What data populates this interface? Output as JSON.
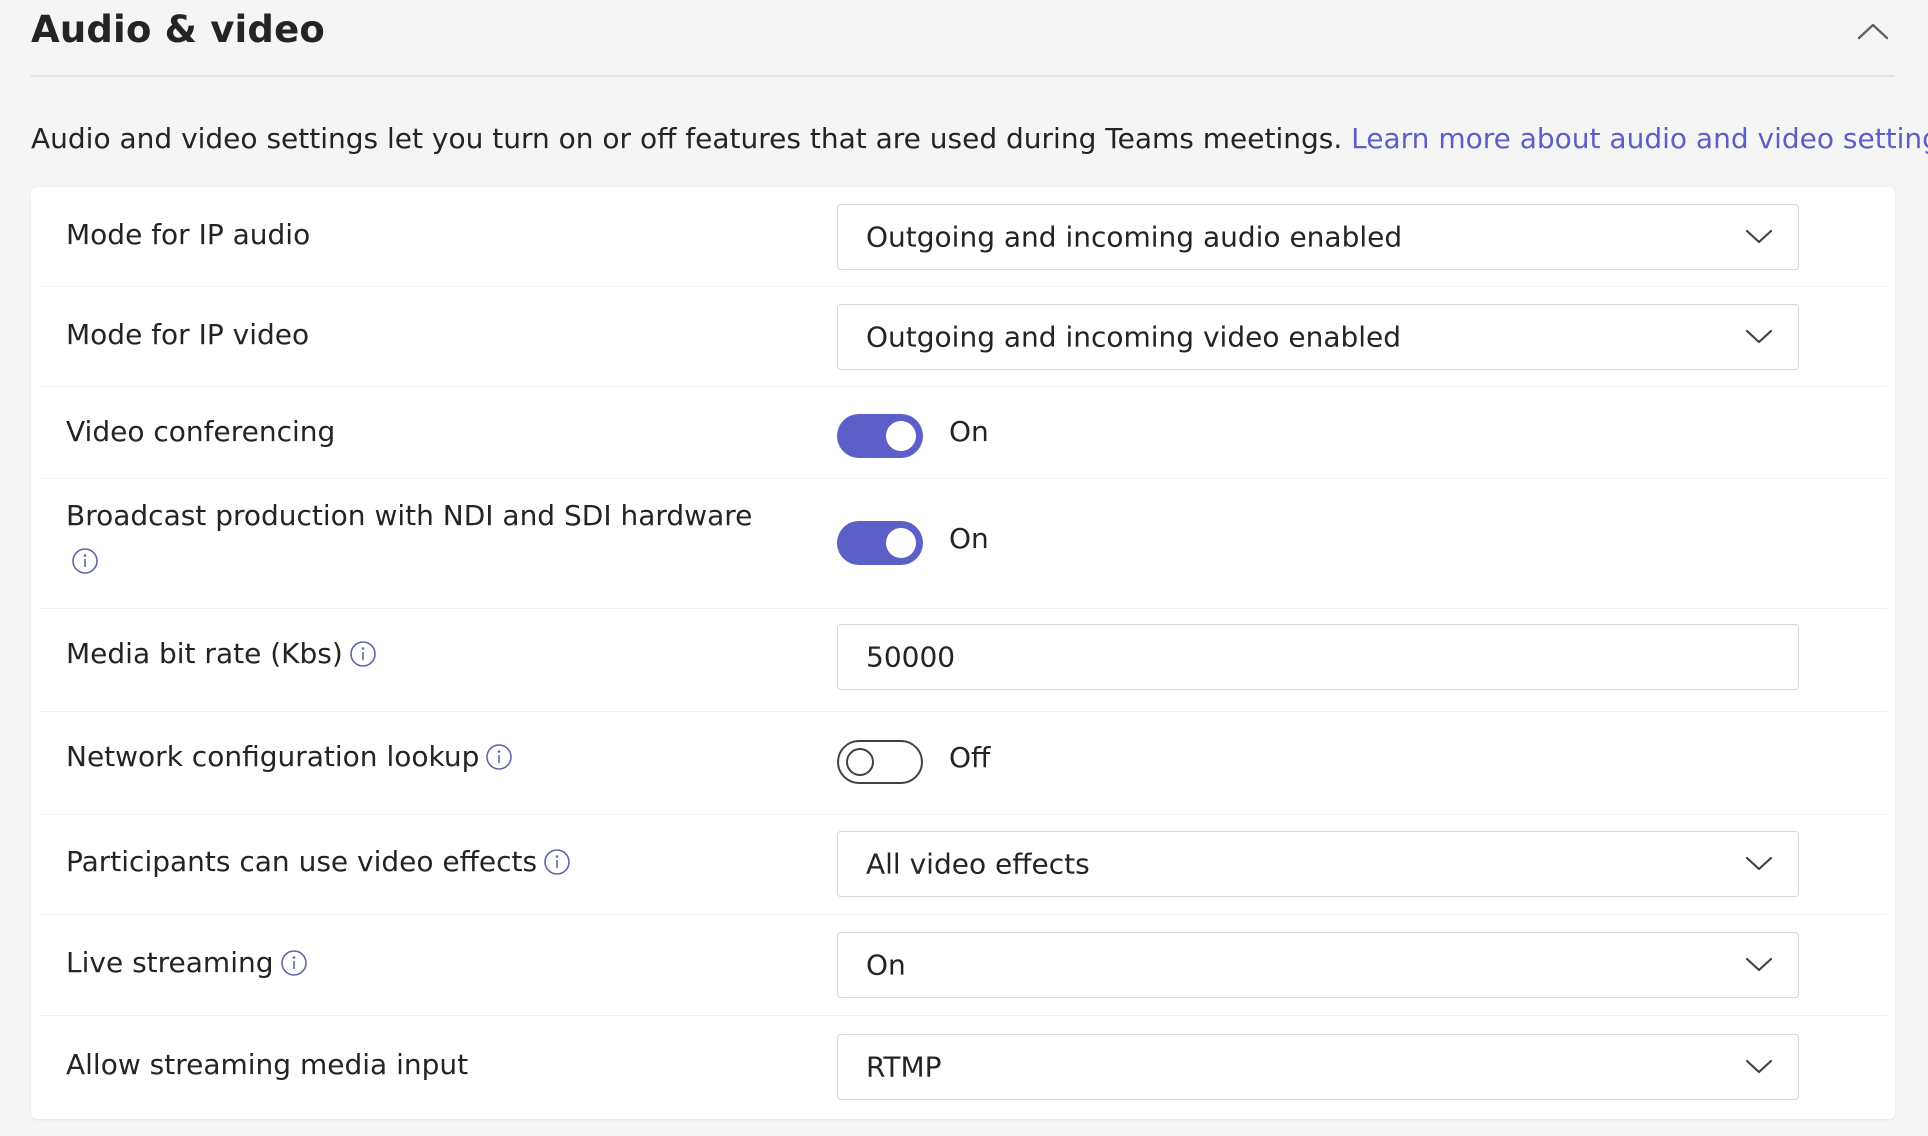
{
  "section": {
    "title": "Audio & video",
    "description": "Audio and video settings let you turn on or off features that are used during Teams meetings.",
    "learn_more_link": "Learn more about audio and video settings"
  },
  "settings": {
    "ip_audio": {
      "label": "Mode for IP audio",
      "value": "Outgoing and incoming audio enabled"
    },
    "ip_video": {
      "label": "Mode for IP video",
      "value": "Outgoing and incoming video enabled"
    },
    "video_conferencing": {
      "label": "Video conferencing",
      "state": "On",
      "enabled": true
    },
    "broadcast_production": {
      "label": "Broadcast production with NDI and SDI hardware",
      "state": "On",
      "enabled": true
    },
    "media_bit_rate": {
      "label": "Media bit rate (Kbs)",
      "value": "50000"
    },
    "network_config_lookup": {
      "label": "Network configuration lookup",
      "state": "Off",
      "enabled": false
    },
    "video_effects": {
      "label": "Participants can use video effects",
      "value": "All video effects"
    },
    "live_streaming": {
      "label": "Live streaming",
      "value": "On"
    },
    "streaming_media_input": {
      "label": "Allow streaming media input",
      "value": "RTMP"
    }
  },
  "colors": {
    "accent": "#5b5fc7",
    "text": "#242424",
    "link": "#5b5fc7",
    "info_icon": "#6264a7",
    "border": "#d6d6d6",
    "page_background": "#f5f5f5",
    "card_background": "#ffffff"
  },
  "icons": {
    "collapse": "chevron-up-icon",
    "dropdown": "chevron-down-icon",
    "info": "info-icon"
  }
}
